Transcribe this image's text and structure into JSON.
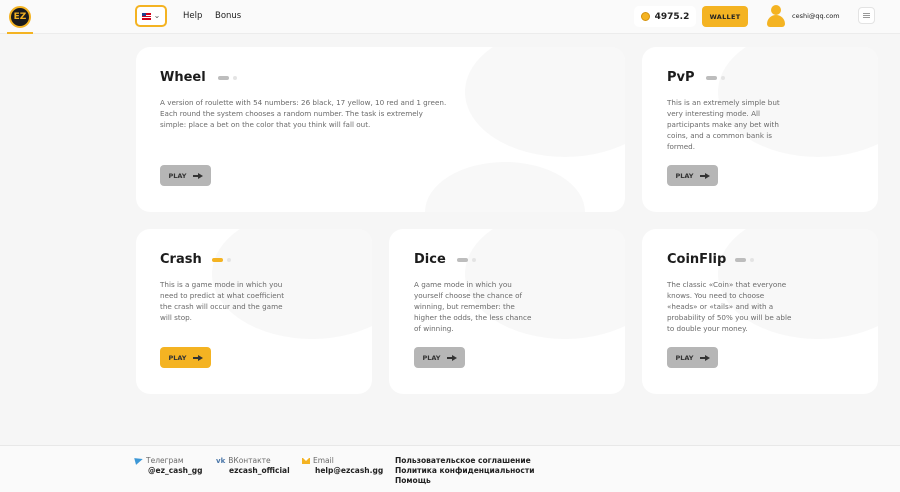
{
  "header": {
    "logo_text": "EZ",
    "nav": [
      {
        "label": "Help"
      },
      {
        "label": "Bonus"
      }
    ],
    "balance": "4975.2",
    "wallet_label": "WALLET",
    "user_email": "ceshi@qq.com"
  },
  "games": [
    {
      "title": "Wheel",
      "description": "A version of roulette with 54 numbers: 26 black, 17 yellow, 10 red and 1 green. Each round the system chooses a random number. The task is extremely simple: place a bet on the color that you think will fall out.",
      "button": "PLAY"
    },
    {
      "title": "PvP",
      "description": "This is an extremely simple but very interesting mode. All participants make any bet with coins, and a common bank is formed.",
      "button": "PLAY"
    },
    {
      "title": "Crash",
      "description": "This is a game mode in which you need to predict at what coefficient the crash will occur and the game will stop.",
      "button": "PLAY"
    },
    {
      "title": "Dice",
      "description": "A game mode in which you yourself choose the chance of winning, but remember: the higher the odds, the less chance of winning.",
      "button": "PLAY"
    },
    {
      "title": "CoinFlip",
      "description": "The classic «Coin» that everyone knows. You need to choose «heads» or «tails» and with a probability of 50% you will be able to double your money.",
      "button": "PLAY"
    }
  ],
  "footer": {
    "telegram_label": "Телеграм",
    "telegram_value": "@ez_cash_gg",
    "vk_label": "ВКонтакте",
    "vk_value": "ezcash_official",
    "vk_icon_text": "vk",
    "email_label": "Email",
    "email_value": "help@ezcash.gg",
    "links": [
      "Пользовательское соглашение",
      "Политика конфиденциальности",
      "Помощь"
    ]
  },
  "colors": {
    "accent": "#f4b322",
    "button_inactive": "#b6b6b6",
    "background": "#f6f6f6"
  }
}
